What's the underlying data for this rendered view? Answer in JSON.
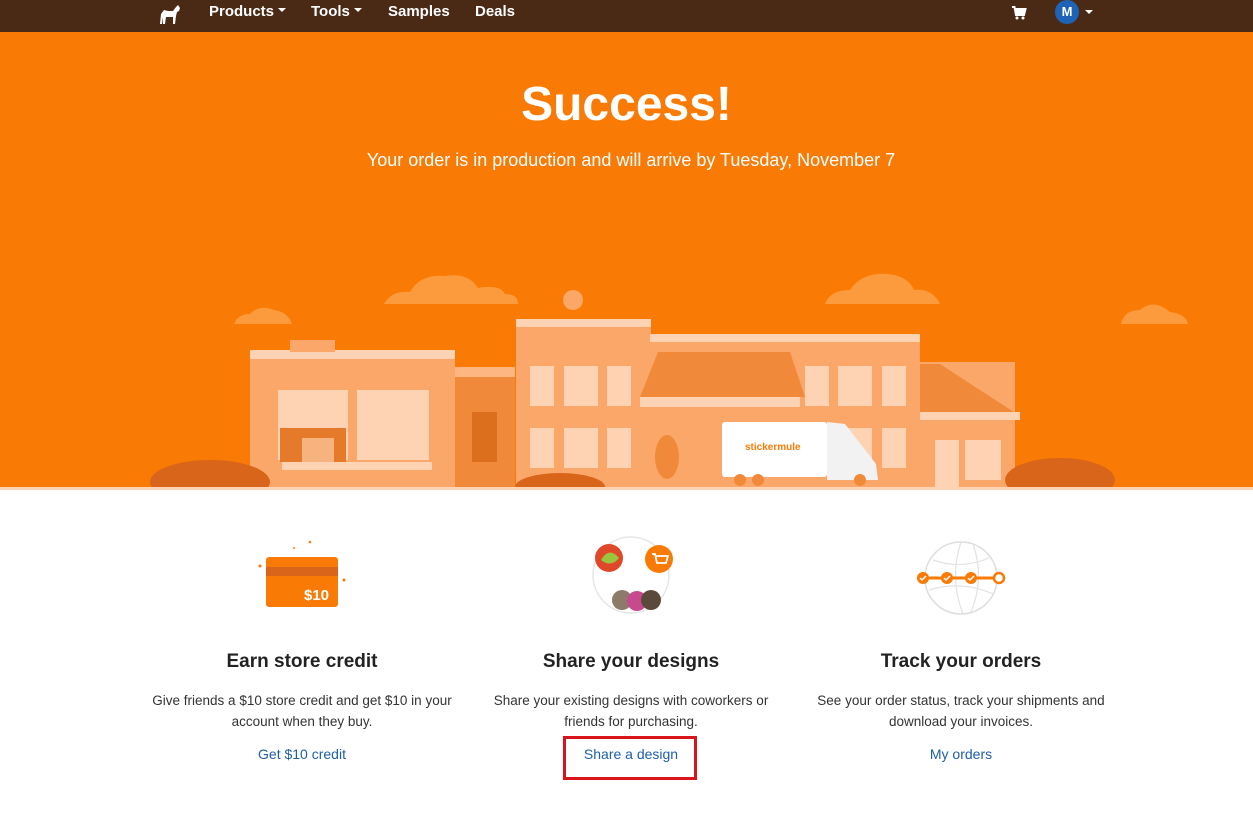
{
  "nav": {
    "items": [
      {
        "label": "Products",
        "has_caret": true
      },
      {
        "label": "Tools",
        "has_caret": true
      },
      {
        "label": "Samples",
        "has_caret": false
      },
      {
        "label": "Deals",
        "has_caret": false
      }
    ],
    "cart_icon": "cart-icon",
    "avatar_initial": "M",
    "brand_icon": "horse-logo-icon"
  },
  "hero": {
    "title": "Success!",
    "subtitle": "Your order is in production and will arrive by Tuesday, November 7",
    "truck_label": "stickermule"
  },
  "features": [
    {
      "title": "Earn store credit",
      "description": "Give friends a $10 store credit and get $10 in your account when they buy.",
      "link": "Get $10 credit",
      "icon": "credit-card-icon",
      "card_amount": "$10"
    },
    {
      "title": "Share your designs",
      "description": "Share your existing designs with coworkers or friends for purchasing.",
      "link": "Share a design",
      "icon": "share-designs-icon"
    },
    {
      "title": "Track your orders",
      "description": "See your order status, track your shipments and download your invoices.",
      "link": "My orders",
      "icon": "tracking-globe-icon"
    }
  ],
  "colors": {
    "nav_bg": "#4a2a15",
    "hero_bg": "#f97b05",
    "link": "#1f5fa8",
    "highlight": "#d9151c"
  }
}
